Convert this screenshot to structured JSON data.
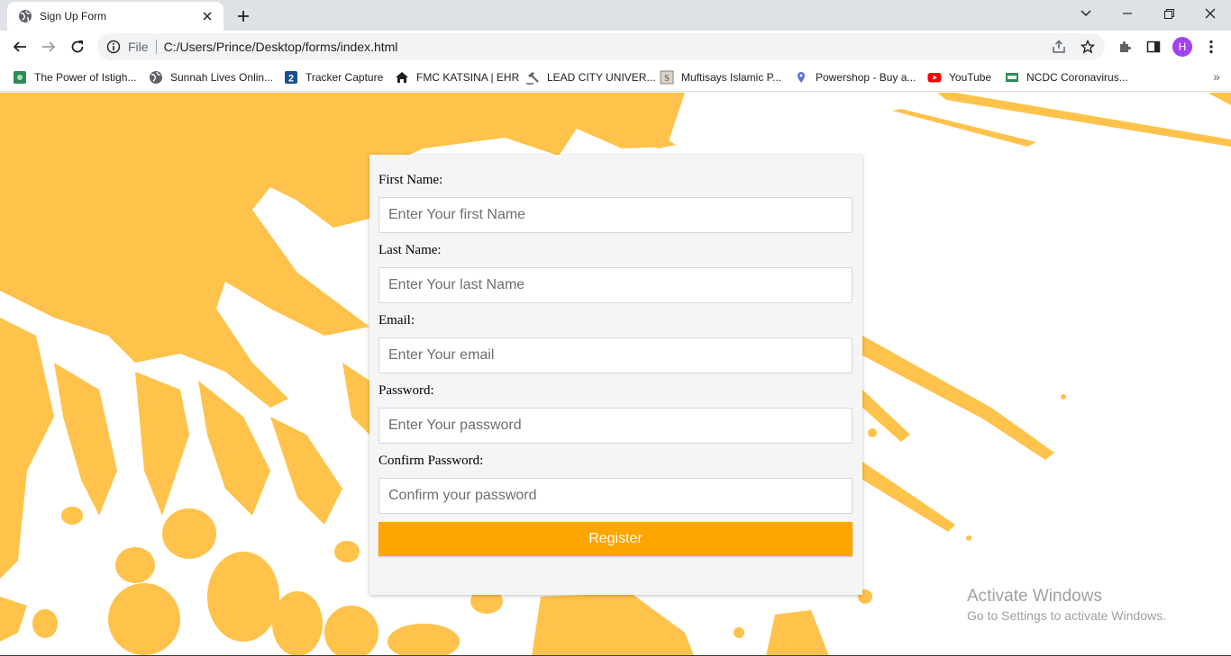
{
  "tab": {
    "title": "Sign Up Form"
  },
  "omnibox": {
    "scheme": "File",
    "url": "C:/Users/Prince/Desktop/forms/index.html"
  },
  "profile": {
    "initial": "H",
    "color": "#a142f4"
  },
  "bookmarks": [
    {
      "label": "The Power of Istigh...",
      "icon": "green-square-icon"
    },
    {
      "label": "Sunnah Lives Onlin...",
      "icon": "globe-icon"
    },
    {
      "label": "Tracker Capture",
      "icon": "dhis2-icon"
    },
    {
      "label": "FMC KATSINA | EHR",
      "icon": "home-icon"
    },
    {
      "label": "LEAD CITY UNIVER...",
      "icon": "gavel-icon"
    },
    {
      "label": "Muftisays Islamic P...",
      "icon": "muftisays-icon"
    },
    {
      "label": "Powershop - Buy a...",
      "icon": "pin-icon"
    },
    {
      "label": "YouTube",
      "icon": "youtube-icon"
    },
    {
      "label": "NCDC Coronavirus...",
      "icon": "ncdc-icon"
    }
  ],
  "form": {
    "fields": [
      {
        "label": "First Name:",
        "placeholder": "Enter Your first Name",
        "type": "text"
      },
      {
        "label": "Last Name:",
        "placeholder": "Enter Your last Name",
        "type": "text"
      },
      {
        "label": "Email:",
        "placeholder": "Enter Your email",
        "type": "email"
      },
      {
        "label": "Password:",
        "placeholder": "Enter Your password",
        "type": "password"
      },
      {
        "label": "Confirm Password:",
        "placeholder": "Confirm your password",
        "type": "password"
      }
    ],
    "submit_label": "Register"
  },
  "watermark": {
    "title": "Activate Windows",
    "subtitle": "Go to Settings to activate Windows."
  },
  "colors": {
    "accent": "#ffa500",
    "splash": "#ffc24a",
    "card": "#f5f5f5"
  }
}
